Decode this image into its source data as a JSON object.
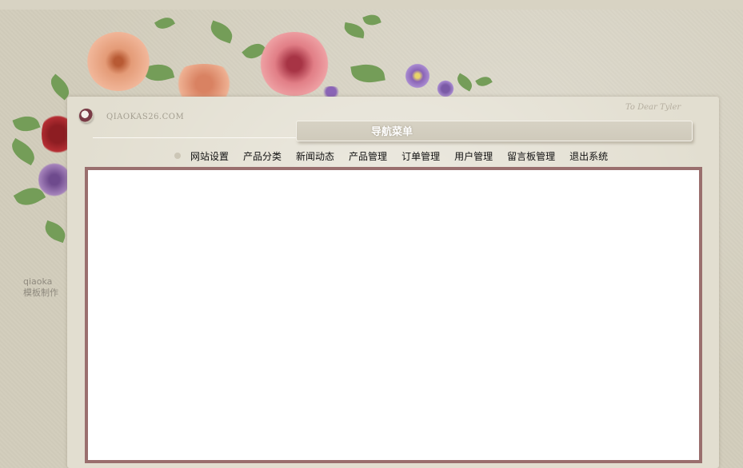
{
  "site": {
    "url_text": "QIAOKAS26.COM",
    "signature": "To Dear Tyler"
  },
  "brand": {
    "name": "qiaoka",
    "subtitle": "模板制作"
  },
  "nav": {
    "title": "导航菜单",
    "items": [
      {
        "label": "网站设置"
      },
      {
        "label": "产品分类"
      },
      {
        "label": "新闻动态"
      },
      {
        "label": "产品管理"
      },
      {
        "label": "订单管理"
      },
      {
        "label": "用户管理"
      },
      {
        "label": "留言板管理"
      },
      {
        "label": "退出系统"
      }
    ]
  },
  "colors": {
    "content_border": "#9a6f6e",
    "background": "#d3cebd",
    "paper": "#e2ded0"
  }
}
